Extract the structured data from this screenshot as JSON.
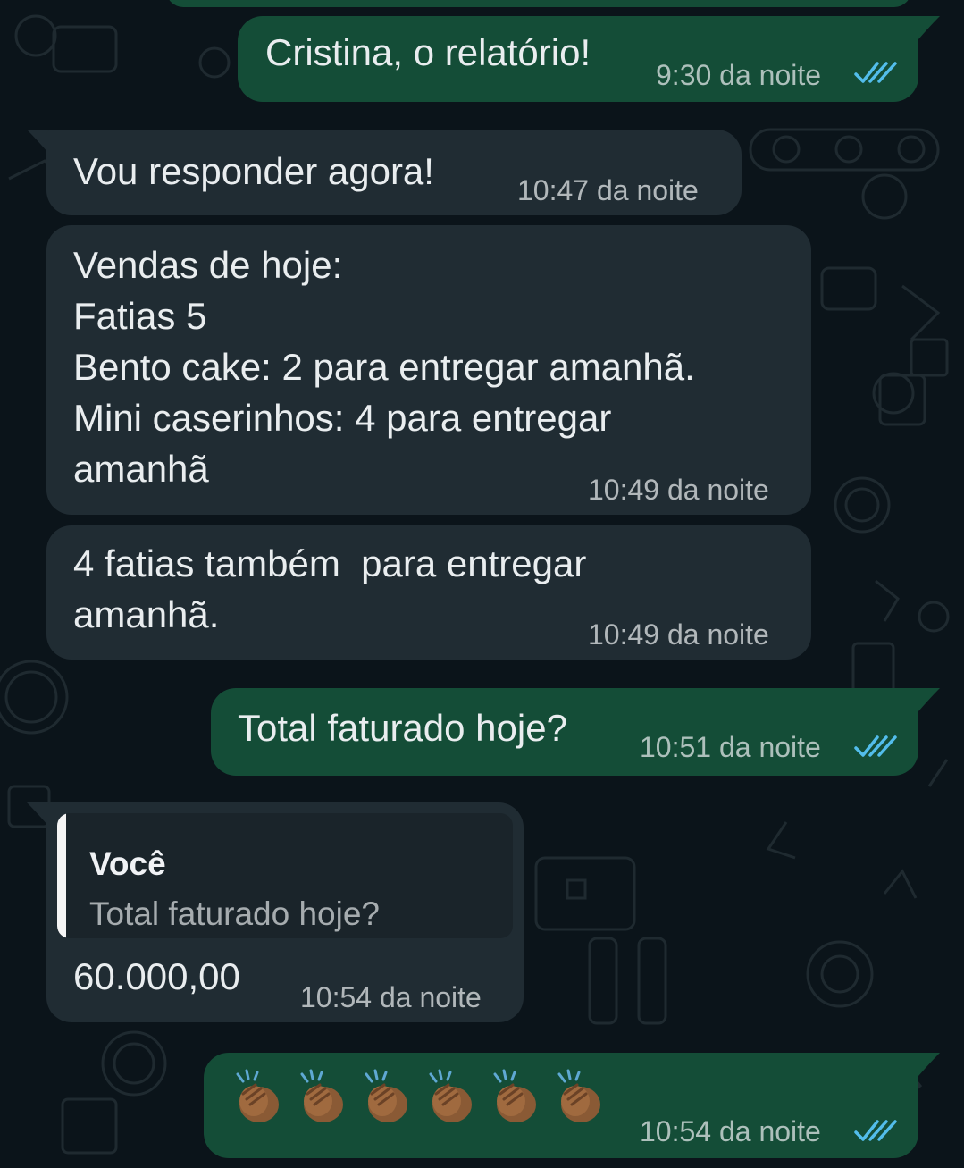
{
  "theme": {
    "background": "#0b141a",
    "outgoing_bubble": "#144d37",
    "incoming_bubble": "#202c33",
    "read_ticks": "#53bdeb"
  },
  "messages": [
    {
      "direction": "out",
      "text": "Cristina, o relatório!",
      "time": "9:30 da noite",
      "status": "read"
    },
    {
      "direction": "in",
      "text": "Vou responder agora!",
      "time": "10:47 da noite"
    },
    {
      "direction": "in",
      "lines": [
        "Vendas de hoje:",
        "Fatias 5",
        "Bento cake: 2 para entregar amanhã.",
        "Mini caserinhos: 4 para entregar",
        "amanhã"
      ],
      "time": "10:49 da noite"
    },
    {
      "direction": "in",
      "lines": [
        "4 fatias também  para entregar",
        "amanhã."
      ],
      "time": "10:49 da noite"
    },
    {
      "direction": "out",
      "text": "Total faturado hoje?",
      "time": "10:51 da noite",
      "status": "read"
    },
    {
      "direction": "in",
      "quote": {
        "author": "Você",
        "text": "Total faturado hoje?"
      },
      "text": "60.000,00",
      "time": "10:54 da noite"
    },
    {
      "direction": "out",
      "emoji": "👏🏾👏🏾👏🏾👏🏾👏🏾👏🏾",
      "emoji_name": "clapping-hands-medium-dark-skin",
      "time": "10:54 da noite",
      "status": "read"
    }
  ]
}
